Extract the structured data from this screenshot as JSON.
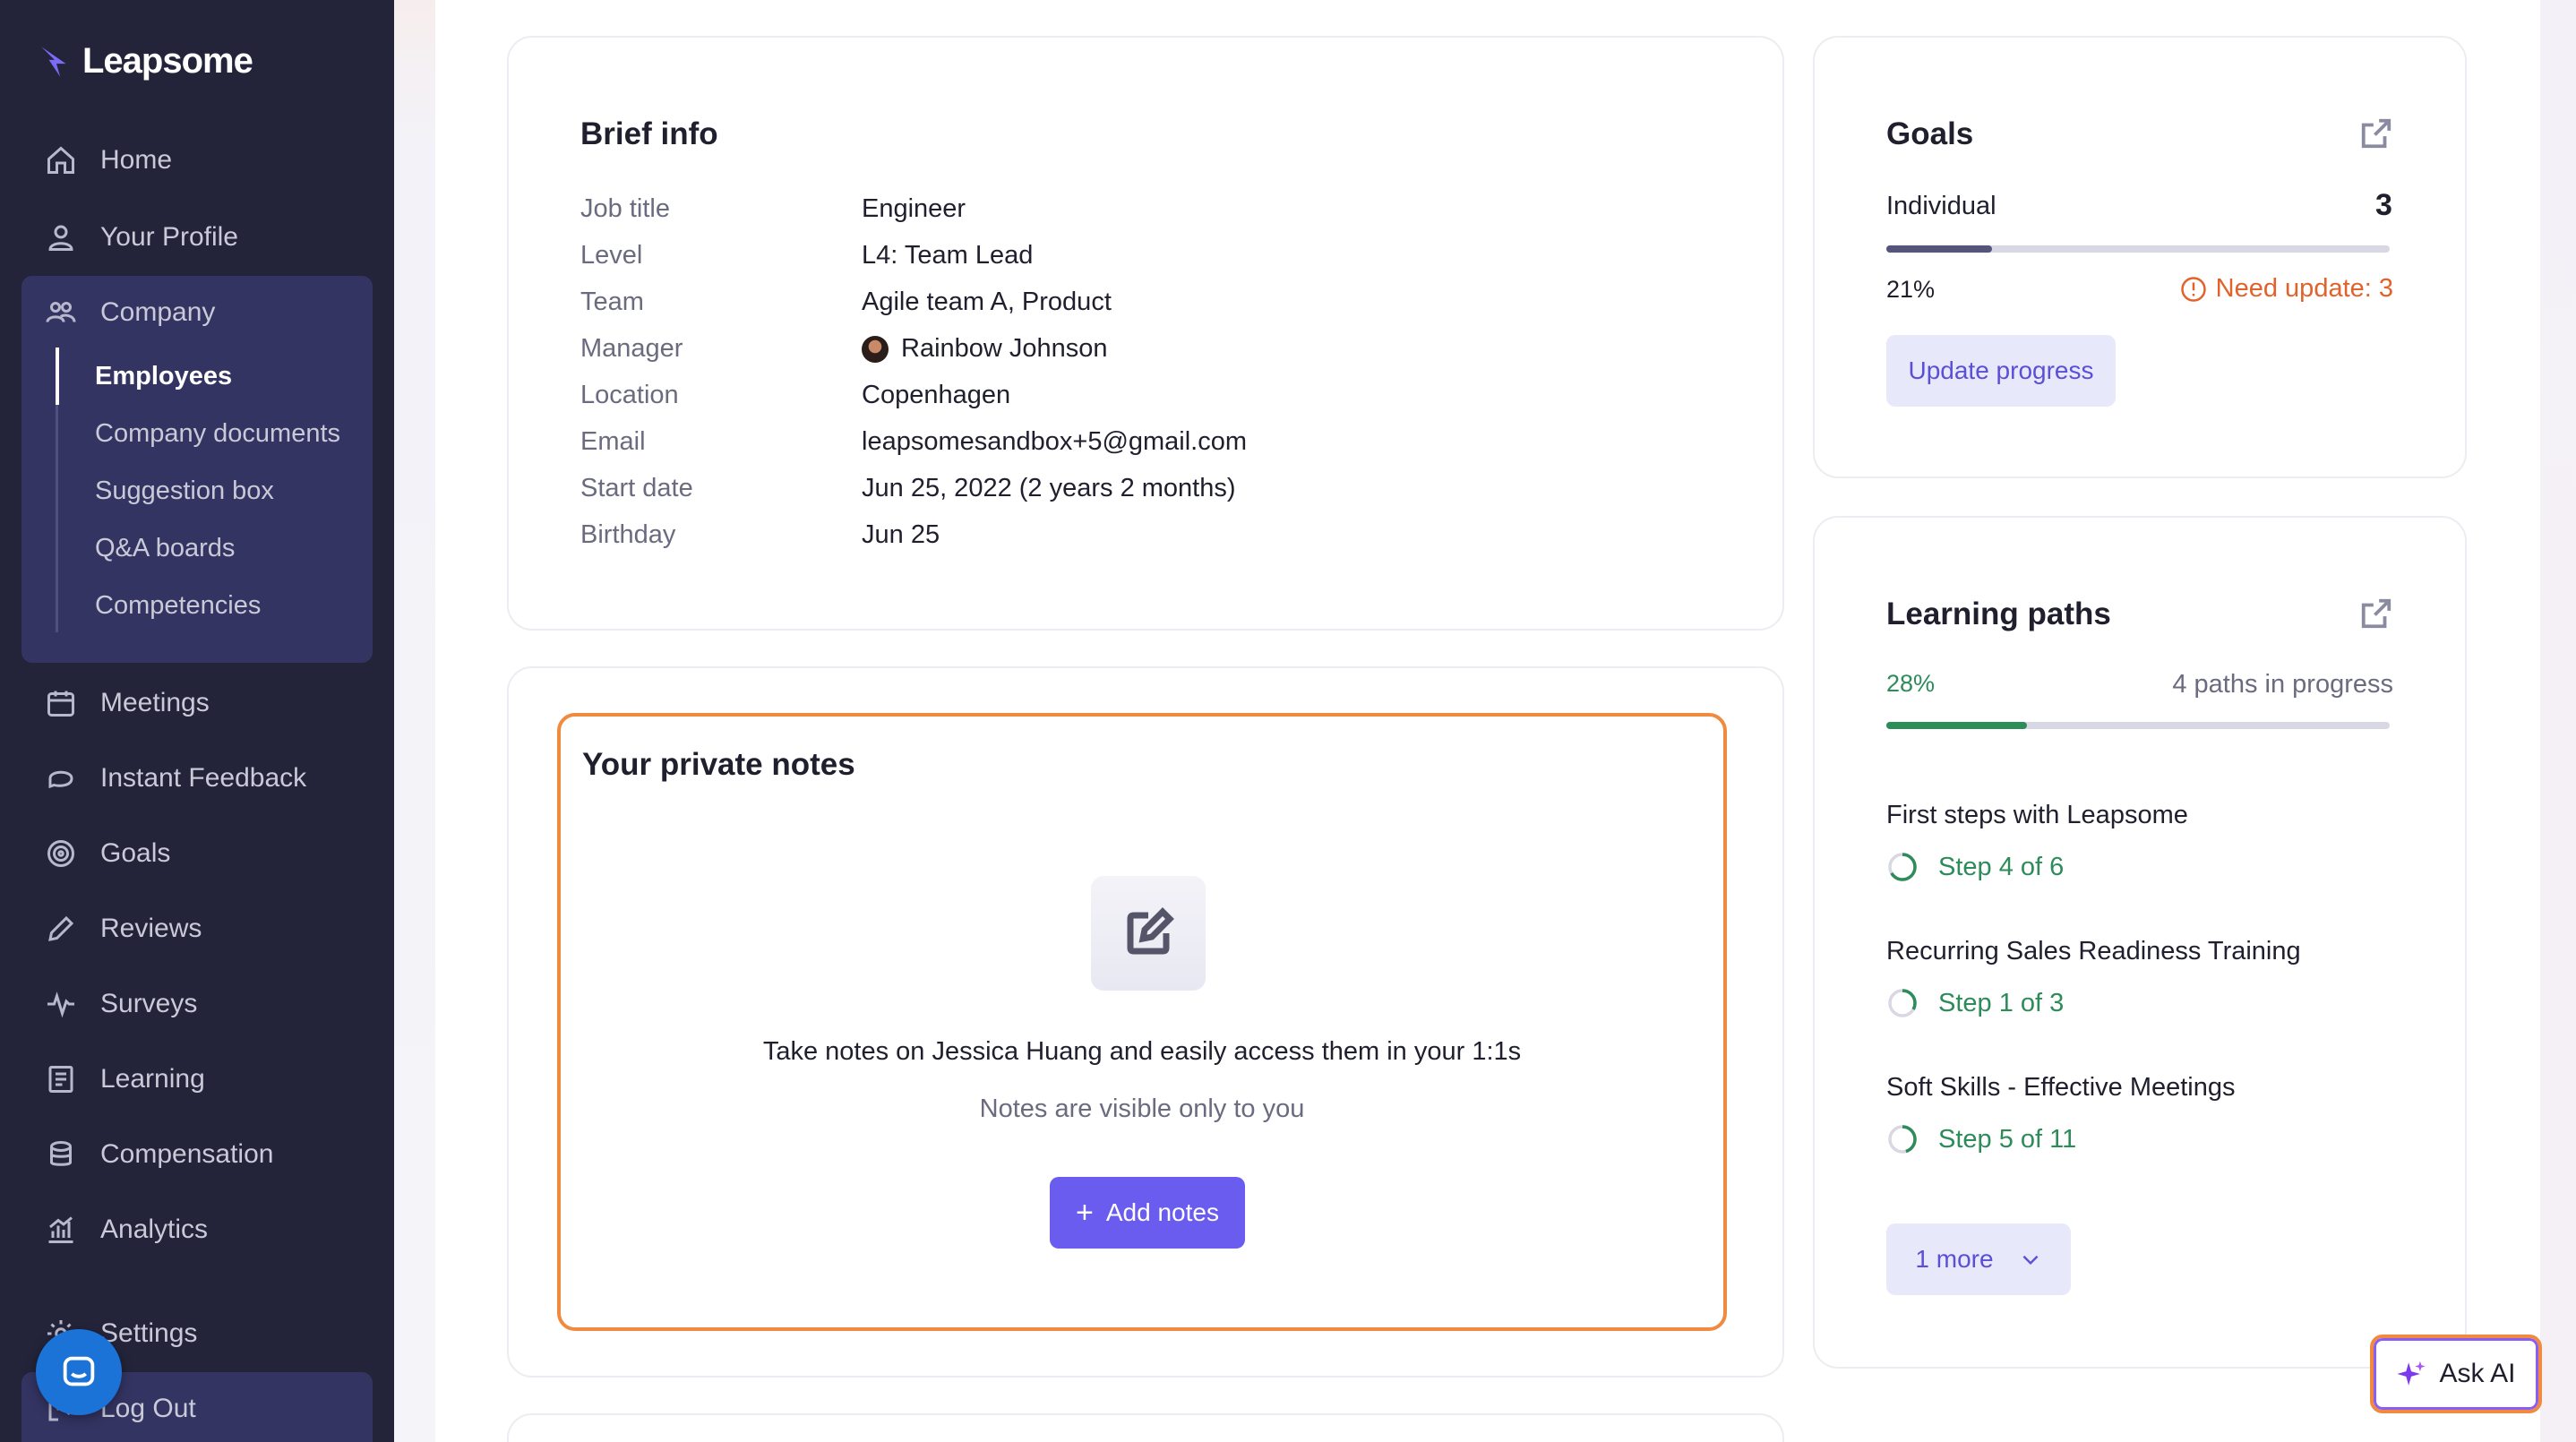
{
  "app": {
    "name": "Leapsome"
  },
  "sidebar": {
    "items": [
      {
        "label": "Home"
      },
      {
        "label": "Your Profile"
      },
      {
        "label": "Company"
      },
      {
        "label": "Meetings"
      },
      {
        "label": "Instant Feedback"
      },
      {
        "label": "Goals"
      },
      {
        "label": "Reviews"
      },
      {
        "label": "Surveys"
      },
      {
        "label": "Learning"
      },
      {
        "label": "Compensation"
      },
      {
        "label": "Analytics"
      },
      {
        "label": "Settings"
      },
      {
        "label": "Log Out"
      }
    ],
    "company_sub": [
      {
        "label": "Employees"
      },
      {
        "label": "Company documents"
      },
      {
        "label": "Suggestion box"
      },
      {
        "label": "Q&A boards"
      },
      {
        "label": "Competencies"
      }
    ],
    "active_sub": "Employees"
  },
  "brief_info": {
    "title": "Brief info",
    "rows": [
      {
        "label": "Job title",
        "value": "Engineer"
      },
      {
        "label": "Level",
        "value": "L4: Team Lead"
      },
      {
        "label": "Team",
        "value": "Agile team A, Product"
      },
      {
        "label": "Manager",
        "value": "Rainbow Johnson"
      },
      {
        "label": "Location",
        "value": "Copenhagen"
      },
      {
        "label": "Email",
        "value": "leapsomesandbox+5@gmail.com"
      },
      {
        "label": "Start date",
        "value": "Jun 25, 2022 (2 years 2 months)"
      },
      {
        "label": "Birthday",
        "value": "Jun 25"
      }
    ]
  },
  "notes": {
    "title": "Your private notes",
    "description": "Take notes on Jessica Huang and easily access them in your 1:1s",
    "visibility": "Notes are visible only to you",
    "add_button": "Add notes"
  },
  "goals": {
    "title": "Goals",
    "individual_label": "Individual",
    "individual_count": "3",
    "progress_text": "21%",
    "progress_fraction": 0.21,
    "need_update": "Need update: 3",
    "update_button": "Update progress"
  },
  "learning": {
    "title": "Learning paths",
    "progress_text": "28%",
    "progress_fraction": 0.28,
    "paths_summary": "4 paths in progress",
    "paths": [
      {
        "name": "First steps with Leapsome",
        "step": "Step 4 of 6",
        "fraction": 0.667
      },
      {
        "name": "Recurring Sales Readiness Training",
        "step": "Step 1 of 3",
        "fraction": 0.333
      },
      {
        "name": "Soft Skills - Effective Meetings",
        "step": "Step 5 of 11",
        "fraction": 0.4545
      }
    ],
    "more_button": "1 more"
  },
  "ask_ai": {
    "label": "Ask AI"
  },
  "colors": {
    "sidebar_bg": "#23233a",
    "accent": "#6b5cf0",
    "highlight_border": "#f08a3e",
    "progress_goals": "#55557a",
    "progress_learning": "#2e8b5a",
    "warning": "#e2622b"
  }
}
